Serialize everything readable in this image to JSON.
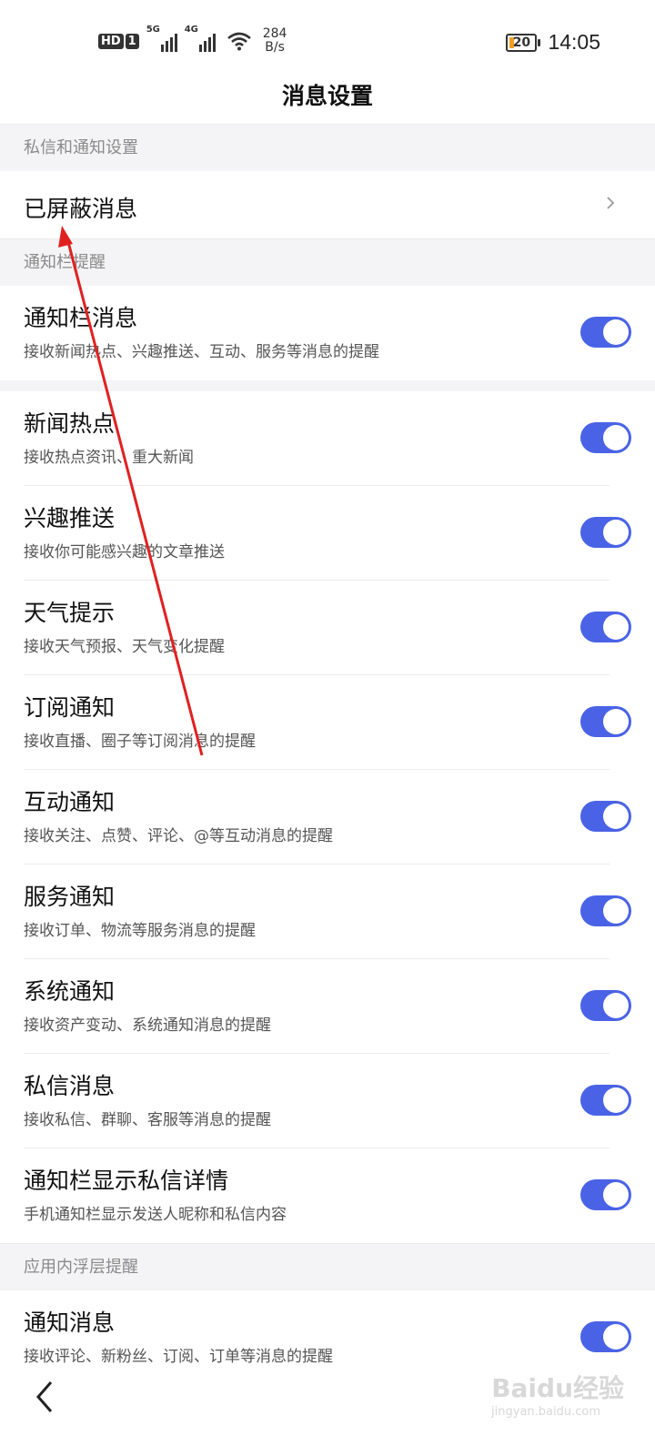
{
  "status_bar": {
    "hd_label": "HD",
    "sim_label": "1",
    "signal1_label": "5G",
    "signal2_label": "4G",
    "net_speed_value": "284",
    "net_speed_unit": "B/s",
    "battery": "20",
    "time": "14:05"
  },
  "header": {
    "title": "消息设置"
  },
  "sections": {
    "private": {
      "label": "私信和通知设置",
      "blocked_title": "已屏蔽消息"
    },
    "notify_bar": {
      "label": "通知栏提醒",
      "master": {
        "title": "通知栏消息",
        "sub": "接收新闻热点、兴趣推送、互动、服务等消息的提醒",
        "on": true
      }
    },
    "items": [
      {
        "title": "新闻热点",
        "sub": "接收热点资讯、重大新闻",
        "on": true
      },
      {
        "title": "兴趣推送",
        "sub": "接收你可能感兴趣的文章推送",
        "on": true
      },
      {
        "title": "天气提示",
        "sub": "接收天气预报、天气变化提醒",
        "on": true
      },
      {
        "title": "订阅通知",
        "sub": "接收直播、圈子等订阅消息的提醒",
        "on": true
      },
      {
        "title": "互动通知",
        "sub": "接收关注、点赞、评论、@等互动消息的提醒",
        "on": true
      },
      {
        "title": "服务通知",
        "sub": "接收订单、物流等服务消息的提醒",
        "on": true
      },
      {
        "title": "系统通知",
        "sub": "接收资产变动、系统通知消息的提醒",
        "on": true
      },
      {
        "title": "私信消息",
        "sub": "接收私信、群聊、客服等消息的提醒",
        "on": true
      },
      {
        "title": "通知栏显示私信详情",
        "sub": "手机通知栏显示发送人昵称和私信内容",
        "on": true
      }
    ],
    "overlay": {
      "label": "应用内浮层提醒",
      "item": {
        "title": "通知消息",
        "sub": "接收评论、新粉丝、订阅、订单等消息的提醒",
        "on": true
      }
    }
  },
  "colors": {
    "toggle_on": "#4a63e6",
    "annotation": "#e02020",
    "section_bg": "#f4f4f6"
  },
  "watermark": {
    "text": "Baidu经验",
    "url": "jingyan.baidu.com"
  }
}
